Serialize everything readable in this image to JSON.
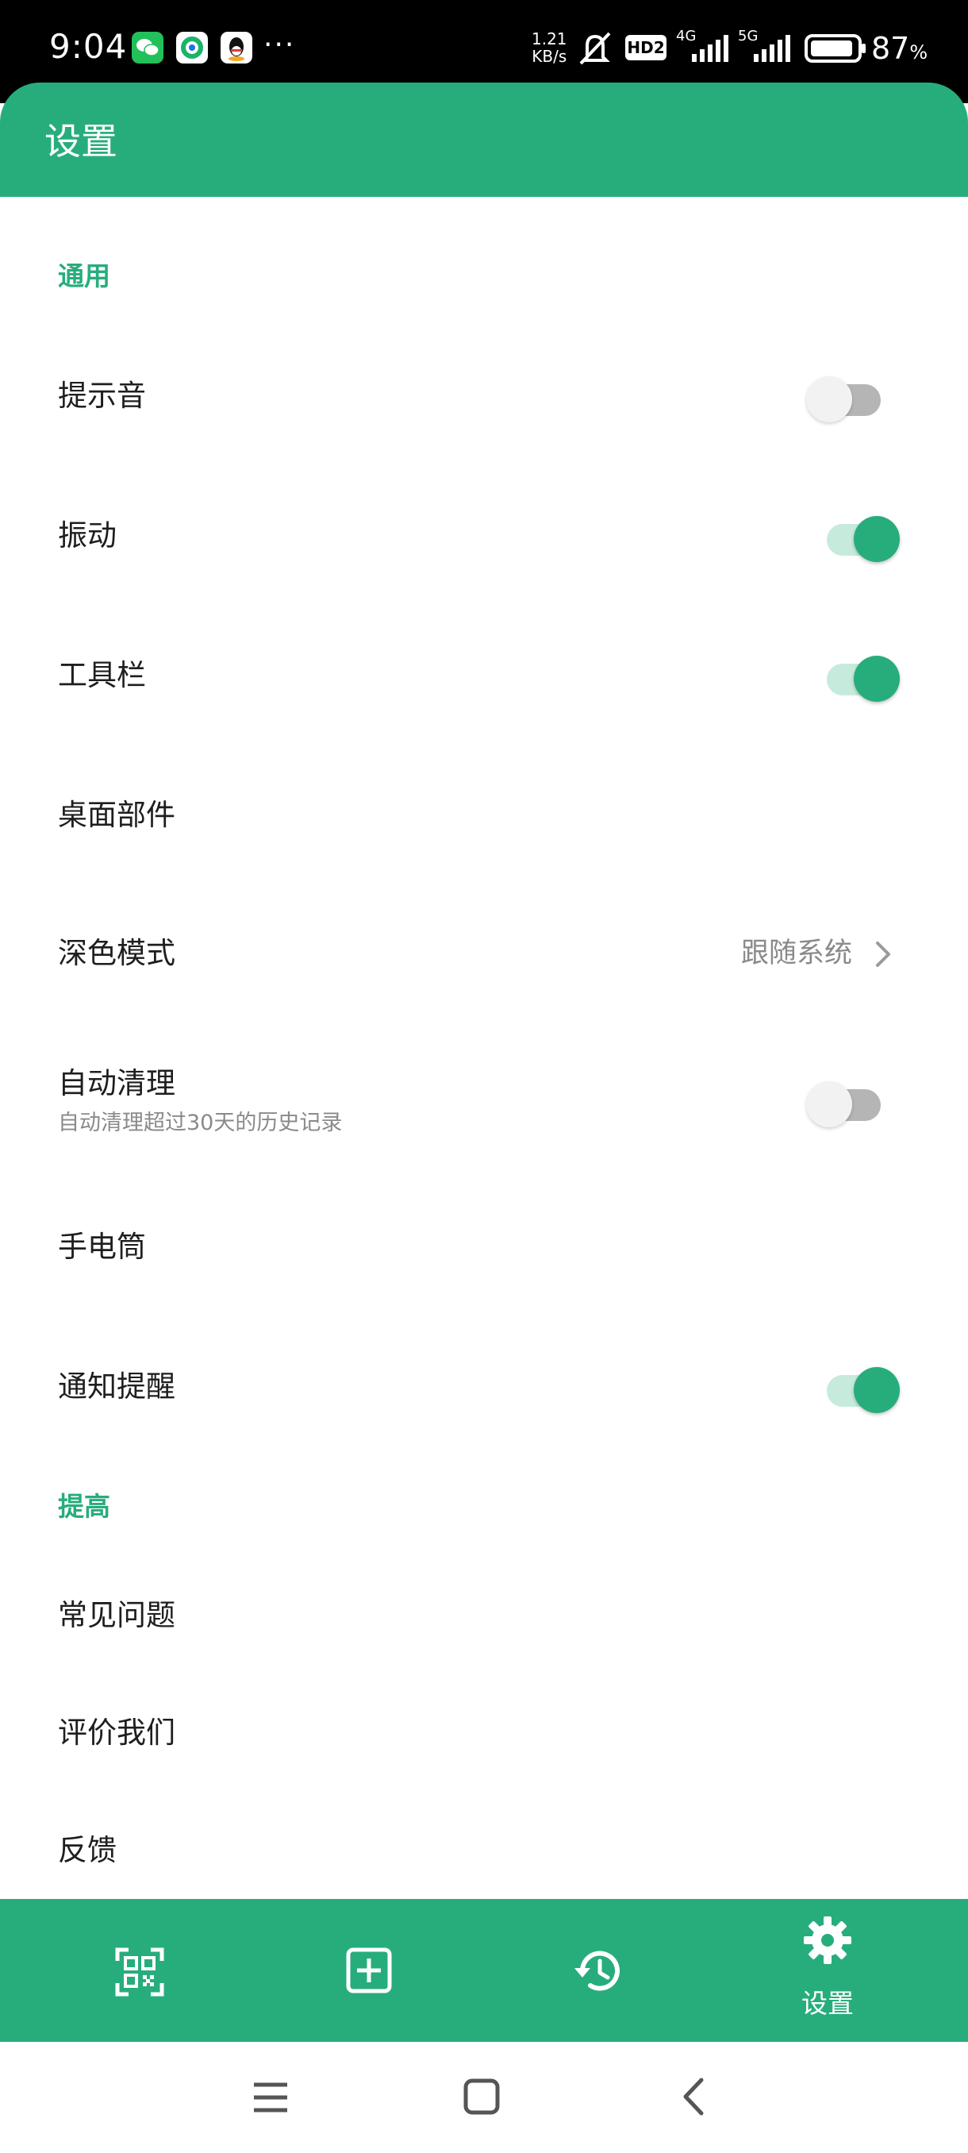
{
  "status_bar": {
    "time": "9:04",
    "more": "···",
    "net_speed_value": "1.21",
    "net_speed_unit": "KB/s",
    "hd_badge": "HD2",
    "signal1_label": "4G",
    "signal2_label": "5G",
    "battery_percent": "87",
    "battery_unit": "%",
    "icons": [
      "wechat-icon",
      "sync-app-icon",
      "qq-icon",
      "mute-icon",
      "signal-icon",
      "battery-icon"
    ]
  },
  "header": {
    "title": "设置",
    "color": "#27ad7c"
  },
  "sections": {
    "general": "通用",
    "improve": "提高"
  },
  "settings": {
    "sound": {
      "label": "提示音",
      "enabled": false
    },
    "vibrate": {
      "label": "振动",
      "enabled": true
    },
    "toolbar": {
      "label": "工具栏",
      "enabled": true
    },
    "widget": {
      "label": "桌面部件"
    },
    "dark_mode": {
      "label": "深色模式",
      "value": "跟随系统"
    },
    "auto_clean": {
      "label": "自动清理",
      "description": "自动清理超过30天的历史记录",
      "enabled": false
    },
    "flashlight": {
      "label": "手电筒"
    },
    "notification": {
      "label": "通知提醒",
      "enabled": true
    },
    "faq": {
      "label": "常见问题"
    },
    "rate": {
      "label": "评价我们"
    },
    "feedback": {
      "label": "反馈"
    }
  },
  "bottom_nav": {
    "items": [
      {
        "icon": "qr-scan-icon"
      },
      {
        "icon": "add-box-icon"
      },
      {
        "icon": "history-icon"
      },
      {
        "icon": "gear-icon",
        "label": "设置",
        "active": true
      }
    ]
  },
  "system_nav": {
    "icons": [
      "menu-icon",
      "home-icon",
      "back-icon"
    ]
  }
}
